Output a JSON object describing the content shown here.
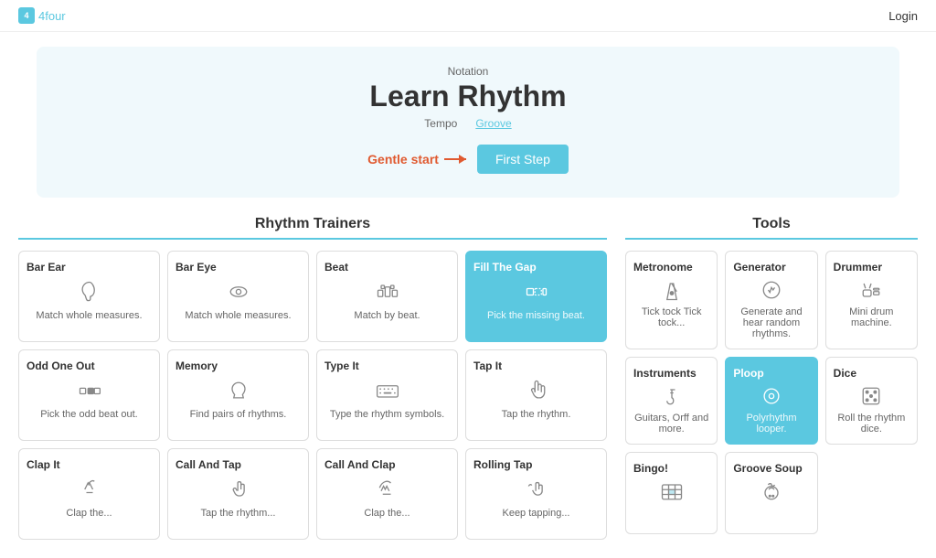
{
  "header": {
    "logo_label": "4four",
    "login_label": "Login"
  },
  "hero": {
    "notation_label": "Notation",
    "title": "Learn Rhythm",
    "tempo_label": "Tempo",
    "groove_label": "Groove",
    "gentle_start": "Gentle start",
    "first_step": "First Step"
  },
  "rhythm_section": {
    "title": "Rhythm Trainers",
    "cards": [
      {
        "id": "bar-ear",
        "title": "Bar Ear",
        "icon": "ear",
        "desc": "Match whole measures.",
        "active": false
      },
      {
        "id": "bar-eye",
        "title": "Bar Eye",
        "icon": "eye",
        "desc": "Match whole measures.",
        "active": false
      },
      {
        "id": "beat",
        "title": "Beat",
        "icon": "beat",
        "desc": "Match by beat.",
        "active": false
      },
      {
        "id": "fill-the-gap",
        "title": "Fill The Gap",
        "icon": "gap",
        "desc": "Pick the missing beat.",
        "active": true
      },
      {
        "id": "odd-one-out",
        "title": "Odd One Out",
        "icon": "odd",
        "desc": "Pick the odd beat out.",
        "active": false
      },
      {
        "id": "memory",
        "title": "Memory",
        "icon": "memory",
        "desc": "Find pairs of rhythms.",
        "active": false
      },
      {
        "id": "type-it",
        "title": "Type It",
        "icon": "keyboard",
        "desc": "Type the rhythm symbols.",
        "active": false
      },
      {
        "id": "tap-it",
        "title": "Tap It",
        "icon": "tap",
        "desc": "Tap the rhythm.",
        "active": false
      },
      {
        "id": "clap-it",
        "title": "Clap It",
        "icon": "clap",
        "desc": "Clap the...",
        "active": false
      },
      {
        "id": "call-and-tap",
        "title": "Call And Tap",
        "icon": "call-tap",
        "desc": "Tap the rhythm...",
        "active": false
      },
      {
        "id": "call-and-clap",
        "title": "Call And Clap",
        "icon": "call-clap",
        "desc": "Clap the...",
        "active": false
      },
      {
        "id": "rolling-tap",
        "title": "Rolling Tap",
        "icon": "rolling-tap",
        "desc": "Keep tapping...",
        "active": false
      }
    ]
  },
  "tools_section": {
    "title": "Tools",
    "cards": [
      {
        "id": "metronome",
        "title": "Metronome",
        "icon": "metronome",
        "desc": "Tick tock Tick tock...",
        "active": false
      },
      {
        "id": "generator",
        "title": "Generator",
        "icon": "generator",
        "desc": "Generate and hear random rhythms.",
        "active": false
      },
      {
        "id": "drummer",
        "title": "Drummer",
        "icon": "drummer",
        "desc": "Mini drum machine.",
        "active": false
      },
      {
        "id": "instruments",
        "title": "Instruments",
        "icon": "instruments",
        "desc": "Guitars, Orff and more.",
        "active": false
      },
      {
        "id": "ploop",
        "title": "Ploop",
        "icon": "ploop",
        "desc": "Polyrhythm looper.",
        "active": true
      },
      {
        "id": "dice",
        "title": "Dice",
        "icon": "dice",
        "desc": "Roll the rhythm dice.",
        "active": false
      },
      {
        "id": "bingo",
        "title": "Bingo!",
        "icon": "bingo",
        "desc": "",
        "active": false
      },
      {
        "id": "groove-soup",
        "title": "Groove Soup",
        "icon": "groove-soup",
        "desc": "",
        "active": false
      }
    ]
  }
}
